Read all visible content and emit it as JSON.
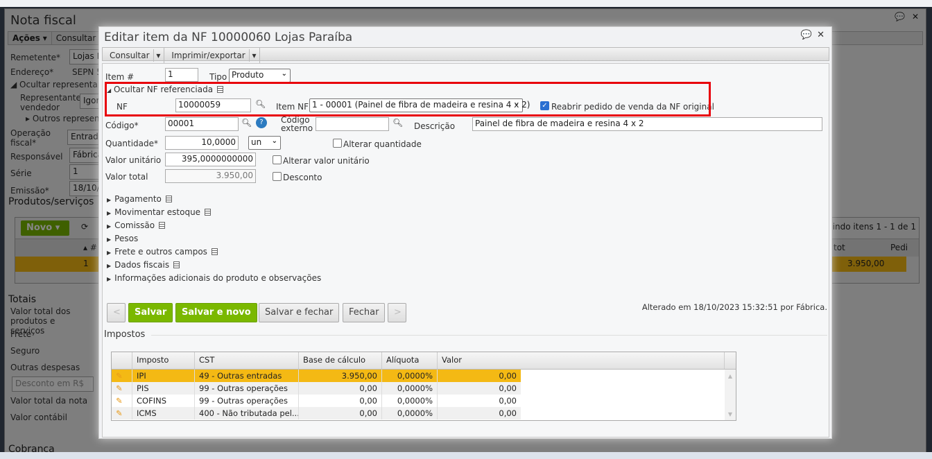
{
  "background": {
    "title": "Nota fiscal",
    "menu": [
      "Ações",
      "Consultar"
    ],
    "fields": [
      {
        "label": "Remetente*",
        "value": "Lojas P"
      },
      {
        "label": "Endereço*",
        "value": "SEPN 5"
      },
      {
        "label": "Ocultar representante"
      },
      {
        "label": "Representante/ vendedor",
        "value": "Igor"
      },
      {
        "label": "Outros representa"
      },
      {
        "label": "Operação fiscal*",
        "value": "Entrada"
      },
      {
        "label": "Responsável",
        "value": "Fábrica"
      },
      {
        "label": "Série",
        "value": "1"
      },
      {
        "label": "Emissão*",
        "value": "18/10/2"
      }
    ],
    "products_title": "Produtos/serviços",
    "new_button": "Novo",
    "paging": "bindo itens 1 - 1 de 1",
    "grid_headers": [
      "#",
      "tot",
      "Pedi"
    ],
    "grid_row": {
      "num": "1",
      "total": "3.950,00"
    },
    "totals_title": "Totais",
    "totals": [
      "Valor total dos produtos e serviços",
      "Frete",
      "Seguro",
      "Outras despesas",
      "Valor total da nota",
      "Valor contábil"
    ],
    "discount_select": "Desconto em R$",
    "cobranca": "Cobrança"
  },
  "modal": {
    "title": "Editar item da NF 10000060 Lojas Paraíba",
    "toolbar": [
      "Consultar",
      "Imprimir/exportar"
    ],
    "item_label": "Item #",
    "item_value": "1",
    "tipo_label": "Tipo",
    "tipo_value": "Produto",
    "ref_section": "Ocultar NF referenciada",
    "nf_label": "NF",
    "nf_value": "10000059",
    "item_nf_label": "Item NF",
    "item_nf_value": "1 - 00001 (Painel de fibra de madeira e resina 4 x 2)",
    "reopen_label": "Reabrir pedido de venda da NF original",
    "reopen_checked": true,
    "codigo_label": "Código*",
    "codigo_value": "00001",
    "codigo_externo_label": "Código externo",
    "codigo_externo_value": "",
    "descricao_label": "Descrição",
    "descricao_value": "Painel de fibra de madeira e resina 4 x 2",
    "quantidade_label": "Quantidade*",
    "quantidade_value": "10,0000",
    "unit_value": "un",
    "alterar_qtd": "Alterar quantidade",
    "valor_unit_label": "Valor unitário",
    "valor_unit_value": "395,0000000000",
    "alterar_valor": "Alterar valor unitário",
    "valor_total_label": "Valor total",
    "valor_total_value": "3.950,00",
    "desconto": "Desconto",
    "sections": [
      "Pagamento",
      "Movimentar estoque",
      "Comissão",
      "Pesos",
      "Frete e outros campos",
      "Dados fiscais",
      "Informações adicionais do produto e observações"
    ],
    "buttons": {
      "prev": "<",
      "save": "Salvar",
      "save_new": "Salvar e novo",
      "save_close": "Salvar e fechar",
      "close": "Fechar",
      "next": ">"
    },
    "changed": "Alterado em 18/10/2023 15:32:51 por Fábrica.",
    "taxes_title": "Impostos",
    "tax_headers": [
      "Imposto",
      "CST",
      "Base de cálculo",
      "Alíquota",
      "Valor"
    ],
    "taxes": [
      {
        "imposto": "IPI",
        "cst": "49 - Outras entradas",
        "base": "3.950,00",
        "aliquota": "0,0000%",
        "valor": "0,00"
      },
      {
        "imposto": "PIS",
        "cst": "99 - Outras operações",
        "base": "0,00",
        "aliquota": "0,0000%",
        "valor": "0,00"
      },
      {
        "imposto": "COFINS",
        "cst": "99 - Outras operações",
        "base": "0,00",
        "aliquota": "0,0000%",
        "valor": "0,00"
      },
      {
        "imposto": "ICMS",
        "cst": "400 - Não tributada pel...",
        "base": "0,00",
        "aliquota": "0,0000%",
        "valor": "0,00"
      }
    ]
  },
  "colors": {
    "accent_green": "#7ab800",
    "highlight": "#f4b914",
    "annotation_red": "#e8000b"
  }
}
